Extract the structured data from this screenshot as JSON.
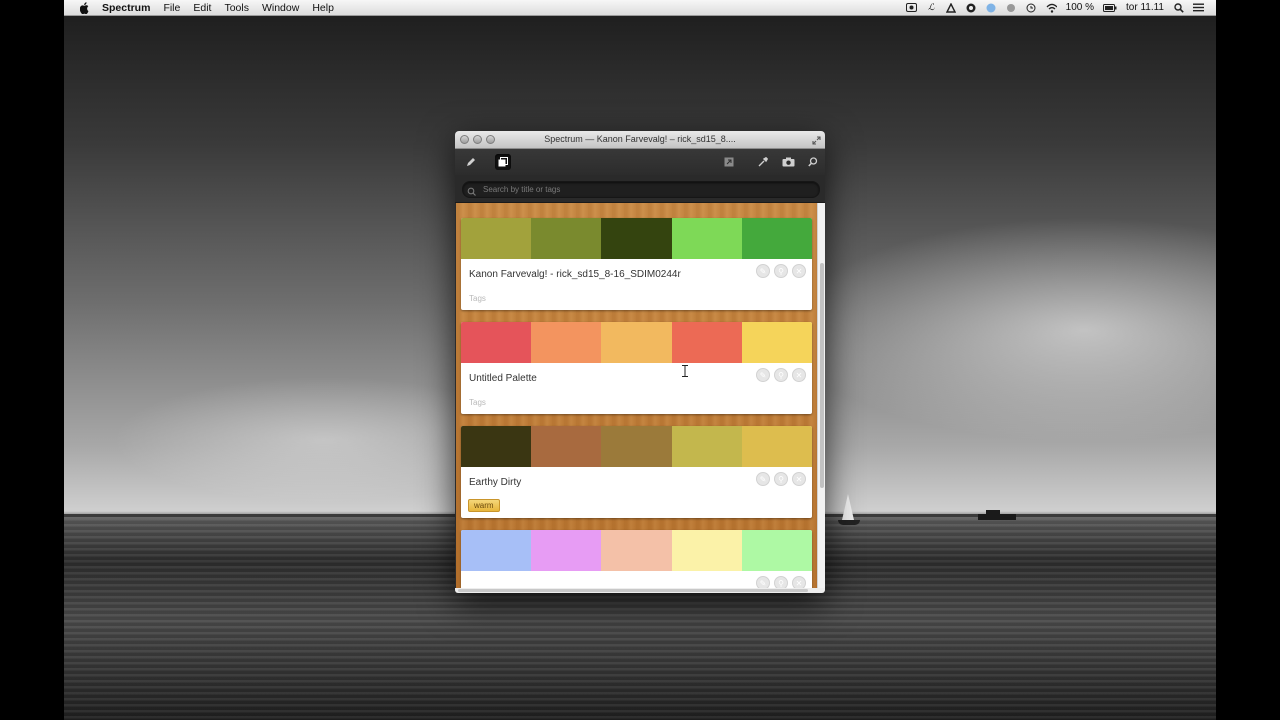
{
  "menubar": {
    "app_name": "Spectrum",
    "items": [
      "File",
      "Edit",
      "Tools",
      "Window",
      "Help"
    ],
    "battery_text": "100 %",
    "clock": "tor 11.11"
  },
  "window": {
    "title": "Spectrum — Kanon Farvevalg! – rick_sd15_8...."
  },
  "search": {
    "placeholder": "Search by title or tags",
    "value": ""
  },
  "palettes": [
    {
      "title": "Kanon Farvevalg! - rick_sd15_8-16_SDIM0244r",
      "tags_placeholder": "Tags",
      "tags": [],
      "colors": [
        "#a2a23c",
        "#7a8a2e",
        "#34440f",
        "#7ed957",
        "#44a93c"
      ]
    },
    {
      "title": "Untitled Palette",
      "tags_placeholder": "Tags",
      "tags": [],
      "colors": [
        "#e5545a",
        "#f3945f",
        "#f2b95f",
        "#ec6a55",
        "#f5d45a"
      ]
    },
    {
      "title": "Earthy Dirty",
      "tags_placeholder": "",
      "tags": [
        "warm"
      ],
      "colors": [
        "#3a3612",
        "#a86a3f",
        "#9b7a3a",
        "#c3b74d",
        "#ddbd4e"
      ]
    },
    {
      "title": "",
      "tags_placeholder": "",
      "tags": [],
      "colors": [
        "#a7bff7",
        "#e79cf4",
        "#f4c1a8",
        "#fbf2a8",
        "#aef9a4"
      ]
    }
  ],
  "icons": {
    "apple": "apple-icon",
    "toolbar_left": [
      "pencil-icon",
      "palettes-icon"
    ],
    "toolbar_right": [
      "export-icon",
      "eyedropper-icon",
      "camera-icon",
      "search-icon"
    ],
    "card_actions": [
      "edit-icon",
      "search-icon",
      "close-icon"
    ]
  }
}
